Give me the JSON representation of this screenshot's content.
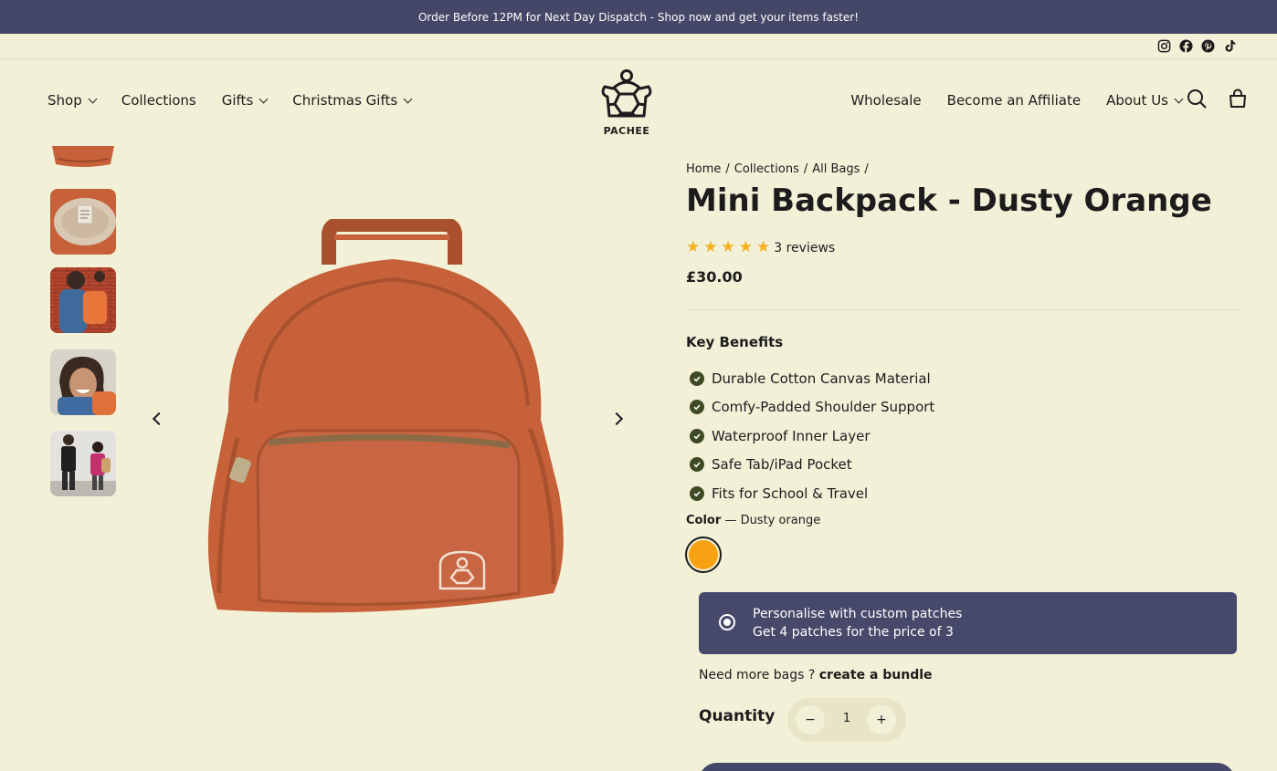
{
  "announcement": "Order Before 12PM for Next Day Dispatch - Shop now and get your items faster!",
  "social": [
    "instagram-icon",
    "facebook-icon",
    "pinterest-icon",
    "tiktok-icon"
  ],
  "nav": {
    "left": [
      {
        "label": "Shop",
        "dropdown": true
      },
      {
        "label": "Collections",
        "dropdown": false
      },
      {
        "label": "Gifts",
        "dropdown": true
      },
      {
        "label": "Christmas Gifts",
        "dropdown": true
      }
    ],
    "right": [
      {
        "label": "Wholesale",
        "dropdown": false
      },
      {
        "label": "Become an Affiliate",
        "dropdown": false
      },
      {
        "label": "About Us",
        "dropdown": true
      }
    ],
    "logo_text": "PACHEE"
  },
  "breadcrumb": [
    "Home",
    "/",
    "Collections",
    "/",
    "All Bags",
    "/"
  ],
  "product": {
    "title": "Mini Backpack - Dusty Orange",
    "stars": 5,
    "reviews": "3 reviews",
    "price": "£30.00",
    "benefits_title": "Key Benefits",
    "benefits": [
      "Durable Cotton Canvas Material",
      "Comfy-Padded Shoulder Support",
      "Waterproof Inner Layer",
      "Safe Tab/iPad Pocket",
      "Fits for School & Travel"
    ],
    "color_label": "Color",
    "color_separator": "—",
    "color_value": "Dusty orange",
    "swatch_color": "#f8a112"
  },
  "patches": {
    "line1": "Personalise with custom patches",
    "line2": "Get 4 patches for the price of 3"
  },
  "bundle": {
    "prefix": "Need more bags ?",
    "link": "create a bundle"
  },
  "quantity": {
    "label": "Quantity",
    "minus": "−",
    "value": "1",
    "plus": "+"
  },
  "colors": {
    "background": "#f3f0d8",
    "accent": "#444767",
    "bag": "#c6613a",
    "star": "#f5b01d"
  }
}
